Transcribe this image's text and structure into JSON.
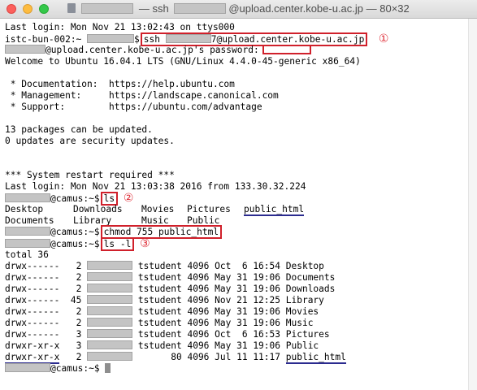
{
  "window": {
    "title_prefix": "",
    "title_middle": "— ssh",
    "title_suffix": "@upload.center.kobe-u.ac.jp — 80×32"
  },
  "terminal": {
    "last_login_1": "Last login: Mon Nov 21 13:02:43 on ttys000",
    "local_prompt": "istc-bun-002:~",
    "local_prompt_end": "$",
    "ssh_cmd": "ssh",
    "ssh_host": "7@upload.center.kobe-u.ac.jp",
    "annotation_1": "①",
    "password_prompt": "@upload.center.kobe-u.ac.jp's password:",
    "welcome": "Welcome to Ubuntu 16.04.1 LTS (GNU/Linux 4.4.0-45-generic x86_64)",
    "doc": " * Documentation:  https://help.ubuntu.com",
    "mgmt": " * Management:     https://landscape.canonical.com",
    "support": " * Support:        https://ubuntu.com/advantage",
    "packages": "13 packages can be updated.",
    "security": "0 updates are security updates.",
    "restart": "*** System restart required ***",
    "last_login_2": "Last login: Mon Nov 21 13:03:38 2016 from 133.30.32.224",
    "remote_prompt": "@camus:~$",
    "cmd_ls": "ls",
    "annotation_2": "②",
    "ls_output": [
      [
        "Desktop",
        "Downloads",
        "Movies",
        "Pictures",
        "public_html"
      ],
      [
        "Documents",
        "Library",
        "Music",
        "Public",
        ""
      ]
    ],
    "cmd_chmod": "chmod 755 public_html",
    "cmd_ls_l": "ls -l",
    "annotation_3": "③",
    "total": "total 36",
    "listing": [
      {
        "perms": "drwx------",
        "links": " 2",
        "user": "tstudent",
        "size": "4096",
        "date": "Oct  6 16:54",
        "name": "Desktop"
      },
      {
        "perms": "drwx------",
        "links": " 2",
        "user": "tstudent",
        "size": "4096",
        "date": "May 31 19:06",
        "name": "Documents"
      },
      {
        "perms": "drwx------",
        "links": " 2",
        "user": "tstudent",
        "size": "4096",
        "date": "May 31 19:06",
        "name": "Downloads"
      },
      {
        "perms": "drwx------",
        "links": "45",
        "user": "tstudent",
        "size": "4096",
        "date": "Nov 21 12:25",
        "name": "Library"
      },
      {
        "perms": "drwx------",
        "links": " 2",
        "user": "tstudent",
        "size": "4096",
        "date": "May 31 19:06",
        "name": "Movies"
      },
      {
        "perms": "drwx------",
        "links": " 2",
        "user": "tstudent",
        "size": "4096",
        "date": "May 31 19:06",
        "name": "Music"
      },
      {
        "perms": "drwx------",
        "links": " 3",
        "user": "tstudent",
        "size": "4096",
        "date": "Oct  6 16:53",
        "name": "Pictures"
      },
      {
        "perms": "drwxr-xr-x",
        "links": " 3",
        "user": "tstudent",
        "size": "4096",
        "date": "May 31 19:06",
        "name": "Public"
      },
      {
        "perms": "drwxr-xr-x",
        "links": " 2",
        "user": "80",
        "size": "4096",
        "date": "Jul 11 11:17",
        "name": "public_html"
      }
    ]
  },
  "icons": {
    "traffic_lights": [
      "close-icon",
      "minimize-icon",
      "zoom-icon"
    ],
    "title_icon": "folder-icon"
  },
  "colors": {
    "annotation_red": "#d0202b",
    "underline_blue": "#2b2b8f",
    "redacted_gray": "#c4c4c4"
  }
}
